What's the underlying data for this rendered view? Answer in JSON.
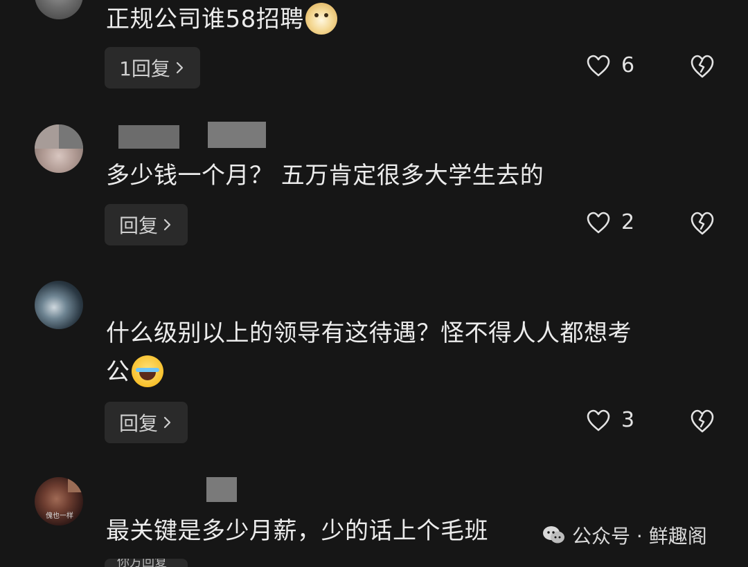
{
  "comments": [
    {
      "text": "正规公司谁58招聘",
      "reply_label": "1回复",
      "likes": "6"
    },
    {
      "text": "多少钱一个月？ 五万肯定很多大学生去的",
      "reply_label": "回复",
      "likes": "2"
    },
    {
      "text_line1": "什么级别以上的领导有这待遇？怪不得人人都想考",
      "text_line2": "公",
      "reply_label": "回复",
      "likes": "3"
    },
    {
      "avatar_caption": "傀也一样",
      "text": "最关键是多少月薪，少的话上个毛班",
      "partial_reply": "你方回复"
    }
  ],
  "watermark": {
    "text": "公众号 · 鲜趣阁"
  },
  "icons": {
    "like": "heart-outline-icon",
    "dislike": "broken-heart-icon",
    "chevron": "chevron-right-icon",
    "emoji_doge": "doge-emoji-icon",
    "emoji_laugh": "laughing-tears-emoji-icon",
    "watermark_logo": "wechat-logo-icon"
  }
}
